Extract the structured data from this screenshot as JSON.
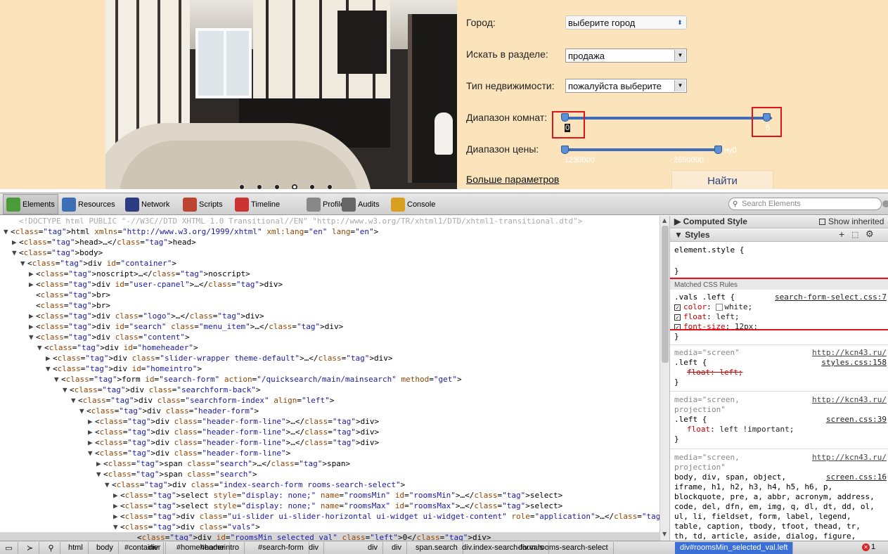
{
  "site": {
    "form": {
      "city_label": "Город:",
      "city_value": "выберите город",
      "section_label": "Искать в разделе:",
      "section_value": "продажа",
      "type_label": "Тип недвижимости:",
      "type_value": "пожалуйста выберите",
      "rooms_label": "Диапазон комнат:",
      "rooms_min_text": "0",
      "rooms_max_text": "5",
      "rooms_range": {
        "min": 0,
        "max": 5,
        "scale_max": 5
      },
      "price_label": "Диапазон цены:",
      "price_min_text": "1230000",
      "price_max_text": "2650000",
      "price_extra_text": "ну0",
      "more_link": "Больше параметров",
      "find_button": "Найти"
    },
    "slider": {
      "count": 6,
      "active": 3
    }
  },
  "devtools": {
    "tabs": [
      {
        "label": "Elements",
        "icon": "elements-icon",
        "selected": true
      },
      {
        "label": "Resources",
        "icon": "resources-icon"
      },
      {
        "label": "Network",
        "icon": "network-icon"
      },
      {
        "label": "Scripts",
        "icon": "scripts-icon"
      },
      {
        "label": "Timeline",
        "icon": "timeline-icon"
      },
      {
        "label": "Profiles",
        "icon": "profiles-icon"
      },
      {
        "label": "Audits",
        "icon": "audits-icon"
      },
      {
        "label": "Console",
        "icon": "console-icon"
      }
    ],
    "search_placeholder": "Search Elements",
    "dom_lines": [
      "<!DOCTYPE html PUBLIC \"-//W3C//DTD XHTML 1.0 Transitional//EN\" \"http://www.w3.org/TR/xhtml1/DTD/xhtml1-transitional.dtd\">",
      "<html xmlns=\"http://www.w3.org/1999/xhtml\" xml:lang=\"en\" lang=\"en\">",
      "<head>…</head>",
      "<body>",
      "<div id=\"container\">",
      "<noscript>…</noscript>",
      "<div id=\"user-cpanel\">…</div>",
      "<br>",
      "<br>",
      "<div class=\"logo\">…</div>",
      "<div id=\"search\" class=\"menu_item\">…</div>",
      "<div class=\"content\">",
      "<div id=\"homeheader\">",
      "<div class=\"slider-wrapper theme-default\">…</div>",
      "<div id=\"homeintro\">",
      "<form id=\"search-form\" action=\"/quicksearch/main/mainsearch\" method=\"get\">",
      "<div class=\"searchform-back\">",
      "<div class=\"searchform-index\" align=\"left\">",
      "<div class=\"header-form\">",
      "<div class=\"header-form-line\">…</div>",
      "<div class=\"header-form-line\">…</div>",
      "<div class=\"header-form-line\">…</div>",
      "<div class=\"header-form-line\">",
      "<span class=\"search\">…</span>",
      "<span class=\"search\">",
      "<div class=\"index-search-form rooms-search-select\">",
      "<select style=\"display: none;\" name=\"roomsMin\" id=\"roomsMin\">…</select>",
      "<select style=\"display: none;\" name=\"roomsMax\" id=\"roomsMax\">…</select>",
      "<div class=\"ui-slider ui-slider-horizontal ui-widget ui-widget-content\" role=\"application\">…</div>",
      "<div class=\"vals\">",
      "<div id=\"roomsMin_selected_val\" class=\"left\">0</div>"
    ],
    "styles": {
      "computed_header": "Computed Style",
      "show_inherited": "Show inherited",
      "styles_header": "Styles",
      "element_style": "element.style {",
      "close_brace": "}",
      "matched_header": "Matched CSS Rules",
      "rule1_selector": ".vals .left {",
      "rule1_source": "search-form-select.css:7",
      "rule1_props": [
        {
          "name": "color",
          "value": "white;",
          "swatch": "#ffffff"
        },
        {
          "name": "float",
          "value": "left;"
        },
        {
          "name": "font-size",
          "value": "12px;"
        }
      ],
      "rule2_media": "media=\"screen\"",
      "rule2_url": "http://kcn43.ru/",
      "rule2_selector": ".left {",
      "rule2_source": "styles.css:158",
      "rule2_prop": "float: left;",
      "rule3_media": "media=\"screen,",
      "rule3_media2": "projection\"",
      "rule3_url": "http://kcn43.ru/",
      "rule3_selector": ".left {",
      "rule3_source": "screen.css:39",
      "rule3_prop_name": "float",
      "rule3_prop_value": ": left !important;",
      "rule4_media": "media=\"screen,",
      "rule4_media2": "projection\"",
      "rule4_url": "http://kcn43.ru/",
      "rule4_source": "screen.css:16",
      "rule4_selector_lines": [
        "body, div, span, object,",
        "iframe, h1, h2, h3, h4, h5, h6, p,",
        "blockquote, pre, a, abbr, acronym, address,",
        "code, del, dfn, em, img, q, dl, dt, dd, ol,",
        "ul, li, fieldset, form, label, legend,",
        "table, caption, tbody, tfoot, thead, tr,",
        "th, td, article, aside, dialog, figure,"
      ]
    },
    "breadcrumbs": [
      "html",
      "body",
      "#container",
      "div",
      "#homeheader",
      "#homeintro",
      "#search-form",
      "div",
      "div",
      "div",
      "span.search",
      "div.index-search-form.rooms-search-select",
      "div.vals",
      "div#roomsMin_selected_val.left"
    ],
    "error_count": "1"
  }
}
